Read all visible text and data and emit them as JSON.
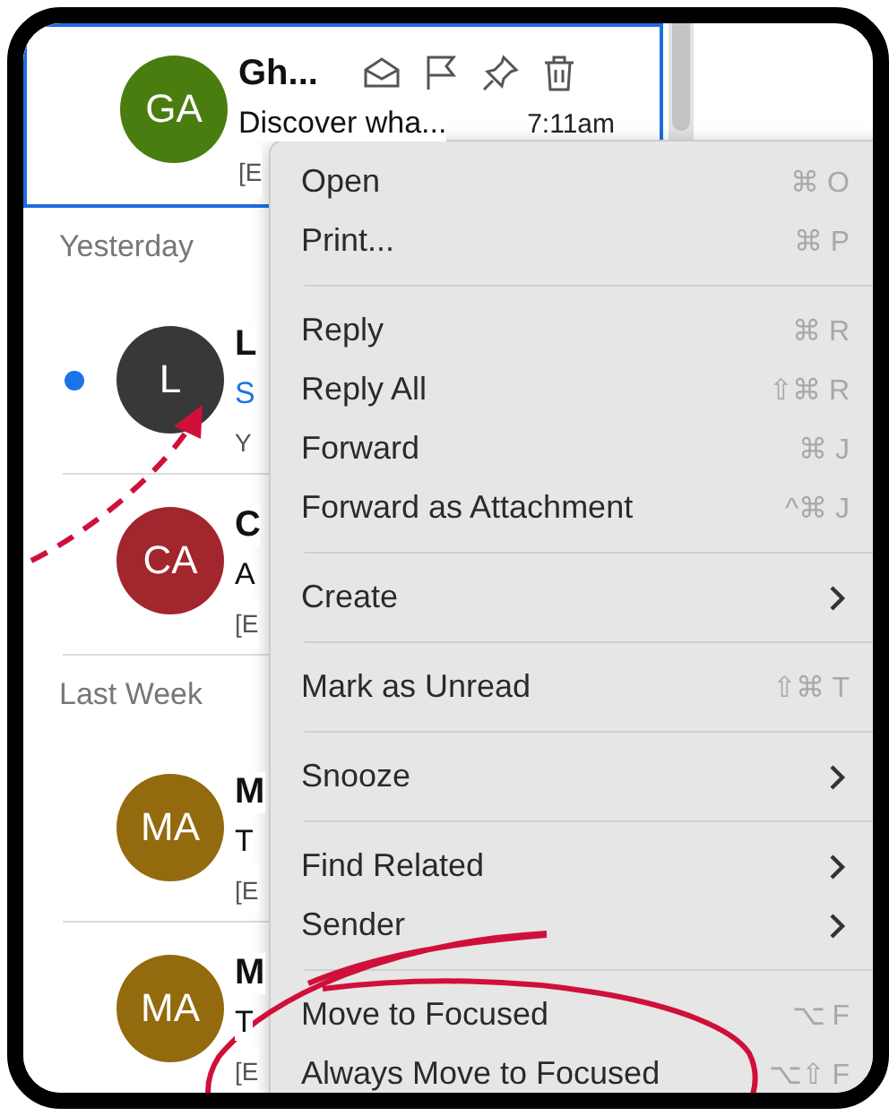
{
  "message_list": [
    {
      "kind": "message",
      "selected": true,
      "unread": false,
      "initials": "GA",
      "color": "#4a7d0f",
      "sender": "Gh...",
      "preview": "Discover wha...",
      "time": "7:11am",
      "extra": "[E"
    },
    {
      "kind": "header",
      "label": "Yesterday"
    },
    {
      "kind": "message",
      "selected": false,
      "unread": true,
      "initials": "L",
      "color": "#383838",
      "sender": "L",
      "preview": "S",
      "extra": "Y"
    },
    {
      "kind": "message",
      "selected": false,
      "unread": false,
      "initials": "CA",
      "color": "#a2262d",
      "sender": "C",
      "preview": "A",
      "extra": "[E"
    },
    {
      "kind": "header",
      "label": "Last Week"
    },
    {
      "kind": "message",
      "selected": false,
      "unread": false,
      "initials": "MA",
      "color": "#936a0d",
      "sender": "M",
      "preview": "T",
      "extra": "[E"
    },
    {
      "kind": "message",
      "selected": false,
      "unread": false,
      "initials": "MA",
      "color": "#936a0d",
      "sender": "M",
      "preview": "T",
      "extra": "[E"
    }
  ],
  "context_menu": [
    {
      "kind": "action",
      "label": "Open",
      "shortcut": "⌘ O"
    },
    {
      "kind": "action",
      "label": "Print...",
      "shortcut": "⌘ P"
    },
    {
      "kind": "separator"
    },
    {
      "kind": "action",
      "label": "Reply",
      "shortcut": "⌘ R"
    },
    {
      "kind": "action",
      "label": "Reply All",
      "shortcut": "⇧⌘ R"
    },
    {
      "kind": "action",
      "label": "Forward",
      "shortcut": "⌘ J"
    },
    {
      "kind": "action",
      "label": "Forward as Attachment",
      "shortcut": "^⌘ J"
    },
    {
      "kind": "separator"
    },
    {
      "kind": "submenu",
      "label": "Create"
    },
    {
      "kind": "separator"
    },
    {
      "kind": "action",
      "label": "Mark as Unread",
      "shortcut": "⇧⌘ T"
    },
    {
      "kind": "separator"
    },
    {
      "kind": "submenu",
      "label": "Snooze"
    },
    {
      "kind": "separator"
    },
    {
      "kind": "submenu",
      "label": "Find Related"
    },
    {
      "kind": "submenu",
      "label": "Sender"
    },
    {
      "kind": "separator"
    },
    {
      "kind": "action",
      "label": "Move to Focused",
      "shortcut": "⌥ F"
    },
    {
      "kind": "action",
      "label": "Always Move to Focused",
      "shortcut": "⌥⇧ F"
    }
  ]
}
